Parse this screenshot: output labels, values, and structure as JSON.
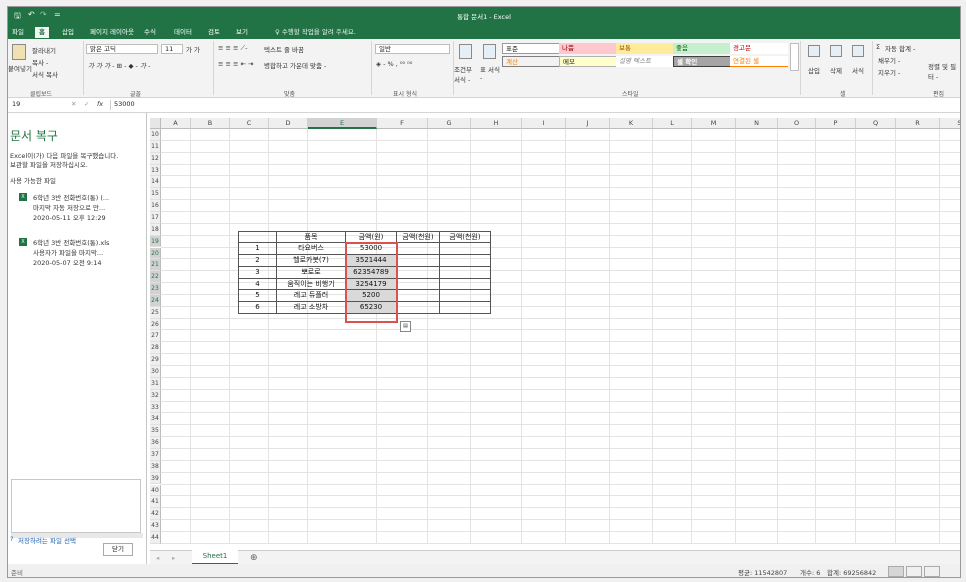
{
  "window": {
    "title": "통합 문서1 - Excel"
  },
  "quick_access": {
    "save_icon": "save-icon",
    "undo_icon": "undo-icon",
    "redo_icon": "redo-icon",
    "customize": "="
  },
  "menu": [
    {
      "label": "파일",
      "active": false
    },
    {
      "label": "홈",
      "active": true
    },
    {
      "label": "삽입",
      "active": false
    },
    {
      "label": "페이지 레이아웃",
      "active": false
    },
    {
      "label": "수식",
      "active": false
    },
    {
      "label": "데이터",
      "active": false
    },
    {
      "label": "검토",
      "active": false
    },
    {
      "label": "보기",
      "active": false
    }
  ],
  "tell_me": "♀ 수행할 작업을 알려 주세요.",
  "ribbon": {
    "clipboard": {
      "cut": "잘라내기",
      "copy": "복사 -",
      "paste": "붙여넣기",
      "format_painter": "서식 복사",
      "label": "클립보드"
    },
    "font": {
      "name": "맑은 고딕",
      "size": "11",
      "label": "글꼴"
    },
    "alignment": {
      "wrap": "텍스트 줄 바꿈",
      "merge": "병합하고 가운데 맞춤 -",
      "label": "맞춤"
    },
    "number": {
      "format": "일반",
      "label": "표시 형식"
    },
    "styles": {
      "conditional": "조건부 서식 -",
      "table": "표 서식 -",
      "normal": "표준",
      "bad": "나쁨",
      "good": "좋음",
      "neutral": "보통",
      "calculation": "계산",
      "note": "메모",
      "explanatory": "설명 텍스트",
      "check_cell": "셀 확인",
      "warning": "경고문",
      "linked": "연결된 셀",
      "label": "스타일"
    },
    "cells": {
      "insert": "삽입",
      "delete": "삭제",
      "format": "서식",
      "label": "셀"
    },
    "editing": {
      "autosum": "자동 합계 -",
      "fill": "채우기 -",
      "clear": "지우기 -",
      "sort": "정렬 및 필터 -",
      "label": "편집"
    }
  },
  "formula_bar": {
    "name_box": "19",
    "fx": "fx",
    "value": "53000"
  },
  "recovery": {
    "title": "문서 복구",
    "desc": [
      "Excel이(가) 다음 파일을 복구했습니다.",
      "보관할 파일을 저장하십시오."
    ],
    "available": "사용 가능한 파일",
    "files": [
      {
        "name": "6학년 3반 전화번호(통) (...",
        "line2": "마지막 자동 저장으로 만...",
        "date": "2020-05-11 오후 12:29"
      },
      {
        "name": "6학년 3반 전화번호(통).xls",
        "line2": "사용자가 파일을 마지막...",
        "date": "2020-05-07 오전 9:14"
      }
    ],
    "help": "저장하려는 파일 선택",
    "close": "닫기"
  },
  "columns": [
    "A",
    "B",
    "C",
    "D",
    "E",
    "F",
    "G",
    "H",
    "I",
    "J",
    "K",
    "L",
    "M",
    "N",
    "O",
    "P",
    "Q",
    "R",
    "S"
  ],
  "rows": [
    "10",
    "11",
    "12",
    "13",
    "14",
    "15",
    "16",
    "17",
    "18",
    "19",
    "20",
    "21",
    "22",
    "23",
    "24",
    "25",
    "26",
    "27",
    "28",
    "29",
    "30",
    "31",
    "32",
    "33",
    "34",
    "35",
    "36",
    "37",
    "38",
    "39",
    "40",
    "41",
    "42",
    "43",
    "44"
  ],
  "table": {
    "headers": [
      "품목",
      "금액(원)",
      "금액(천원)",
      "금액(천원)"
    ],
    "rows": [
      {
        "num": "1",
        "item": "타요버스",
        "amount": "53000"
      },
      {
        "num": "2",
        "item": "헬로카봇(7)",
        "amount": "3521444"
      },
      {
        "num": "3",
        "item": "뽀로로",
        "amount": "62354789"
      },
      {
        "num": "4",
        "item": "움직이는 비행기",
        "amount": "3254179"
      },
      {
        "num": "5",
        "item": "레고 듀플러",
        "amount": "5200"
      },
      {
        "num": "6",
        "item": "레고 소방차",
        "amount": "65230"
      }
    ]
  },
  "sheet_tab": "Sheet1",
  "status": {
    "left": "준비",
    "average": "평균: 11542807",
    "count": "개수: 6",
    "sum": "합계: 69256842"
  },
  "colors": {
    "accent": "#217346",
    "selection": "#d9534f"
  }
}
